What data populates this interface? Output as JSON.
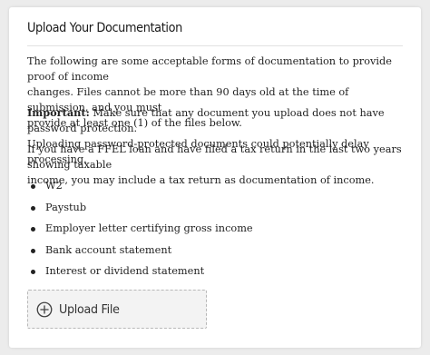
{
  "card": {
    "title": "Upload Your Documentation",
    "intro_lines": [
      "The following are some acceptable forms of documentation to provide proof of income",
      "changes. Files cannot be more than 90 days old at the time of submission, and you must",
      "provide at least one (1) of the files below."
    ],
    "important_label": "Important:",
    "important_lines": [
      " Make sure that any document you upload does not have password protection.",
      "Uploading password-protected documents could potentially delay processing."
    ],
    "ffel_lines": [
      "If you have a FFEL loan and have filed a tax return in the last two years showing taxable",
      "income, you may include a tax return as documentation of income."
    ],
    "documents": [
      "W2",
      "Paystub",
      "Employer letter certifying gross income",
      "Bank account statement",
      "Interest or dividend statement"
    ],
    "upload_button_label": "Upload File",
    "upload_icon": "plus-circle-icon"
  }
}
